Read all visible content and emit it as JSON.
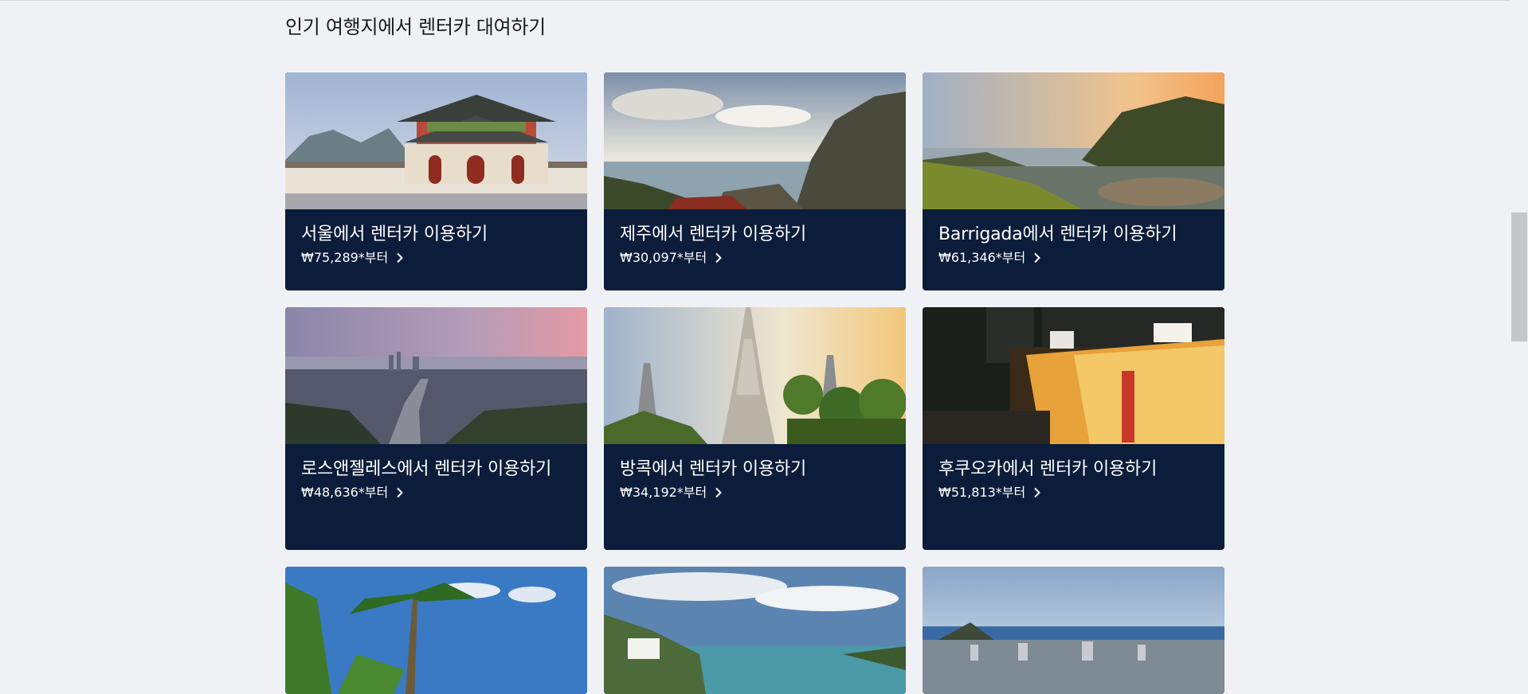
{
  "section": {
    "title": "인기 여행지에서 렌터카 대여하기"
  },
  "cards": [
    {
      "title": "서울에서 렌터카 이용하기",
      "price": "₩75,289*부터",
      "image": "seoul-gyeongbokgung-gate-photo"
    },
    {
      "title": "제주에서 렌터카 이용하기",
      "price": "₩30,097*부터",
      "image": "jeju-coastal-cliff-photo"
    },
    {
      "title": "Barrigada에서 렌터카 이용하기",
      "price": "₩61,346*부터",
      "image": "guam-sunset-coast-photo"
    },
    {
      "title": "로스앤젤레스에서 렌터카 이용하기",
      "price": "₩48,636*부터",
      "image": "los-angeles-city-dusk-photo"
    },
    {
      "title": "방콕에서 렌터카 이용하기",
      "price": "₩34,192*부터",
      "image": "bangkok-wat-arun-photo"
    },
    {
      "title": "후쿠오카에서 렌터카 이용하기",
      "price": "₩51,813*부터",
      "image": "fukuoka-yatai-street-photo"
    },
    {
      "image": "tropical-palm-trees-photo"
    },
    {
      "image": "coastal-bay-photo"
    },
    {
      "image": "honolulu-cityscape-photo"
    }
  ],
  "icons": {
    "chevron": "chevron-right-icon"
  },
  "colors": {
    "background": "#f0f1f4",
    "card": "#0b1d3a",
    "text": "#1a1a1a"
  }
}
